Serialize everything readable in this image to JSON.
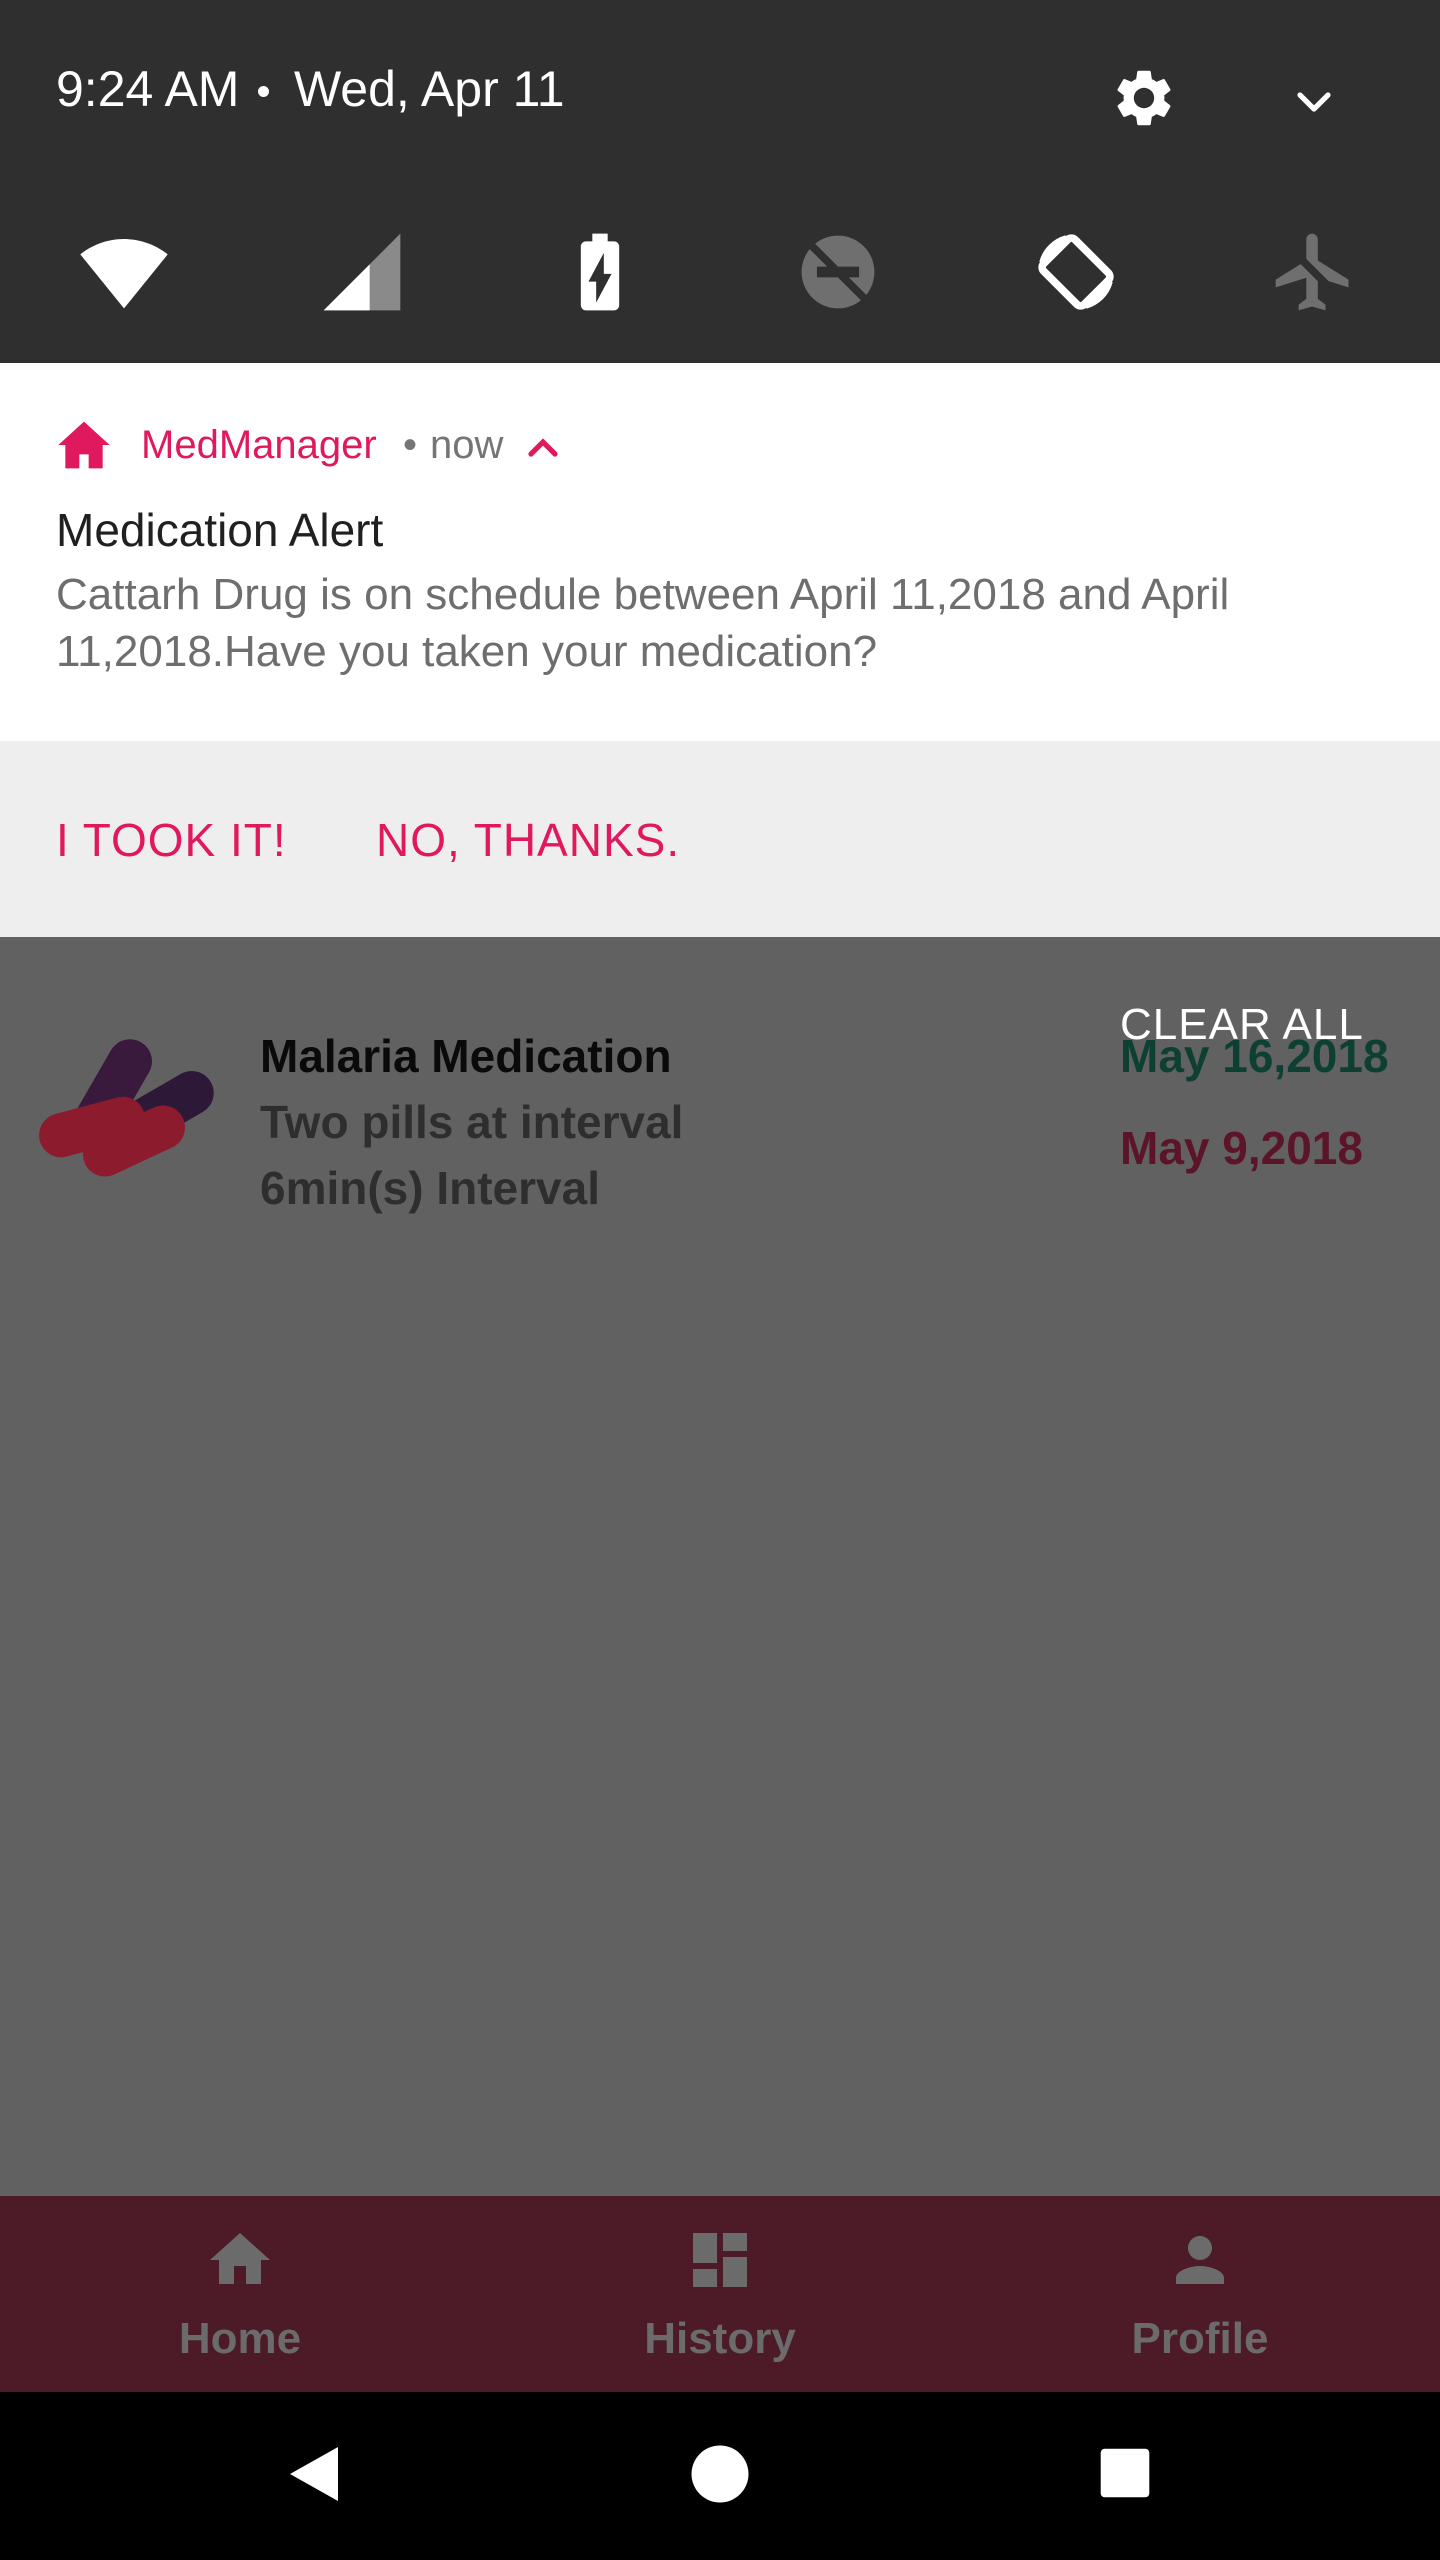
{
  "status": {
    "time": "9:24 AM",
    "date": "Wed, Apr 11",
    "icons": [
      "settings-icon",
      "expand-icon"
    ]
  },
  "quick_tiles": [
    "wifi-icon",
    "cell-signal-icon",
    "battery-charging-icon",
    "do-not-disturb-icon",
    "auto-rotate-icon",
    "airplane-mode-icon"
  ],
  "notification": {
    "app_name": "MedManager",
    "separator": "•",
    "time": "now",
    "title": "Medication Alert",
    "body": "Cattarh Drug is on schedule between April 11,2018 and April 11,2018.Have you taken your medication?",
    "actions": {
      "took": "I TOOK IT!",
      "decline": "NO, THANKS."
    },
    "accent_color": "#e0195f"
  },
  "medication": {
    "name": "Malaria Medication",
    "description": "Two pills at interval",
    "interval": "6min(s) Interval",
    "end_date": "May 16,2018",
    "start_date": "May 9,2018"
  },
  "clear_all": "CLEAR ALL",
  "bottom_nav": {
    "home": "Home",
    "history": "History",
    "profile": "Profile",
    "bar_color": "#4d1a28"
  }
}
